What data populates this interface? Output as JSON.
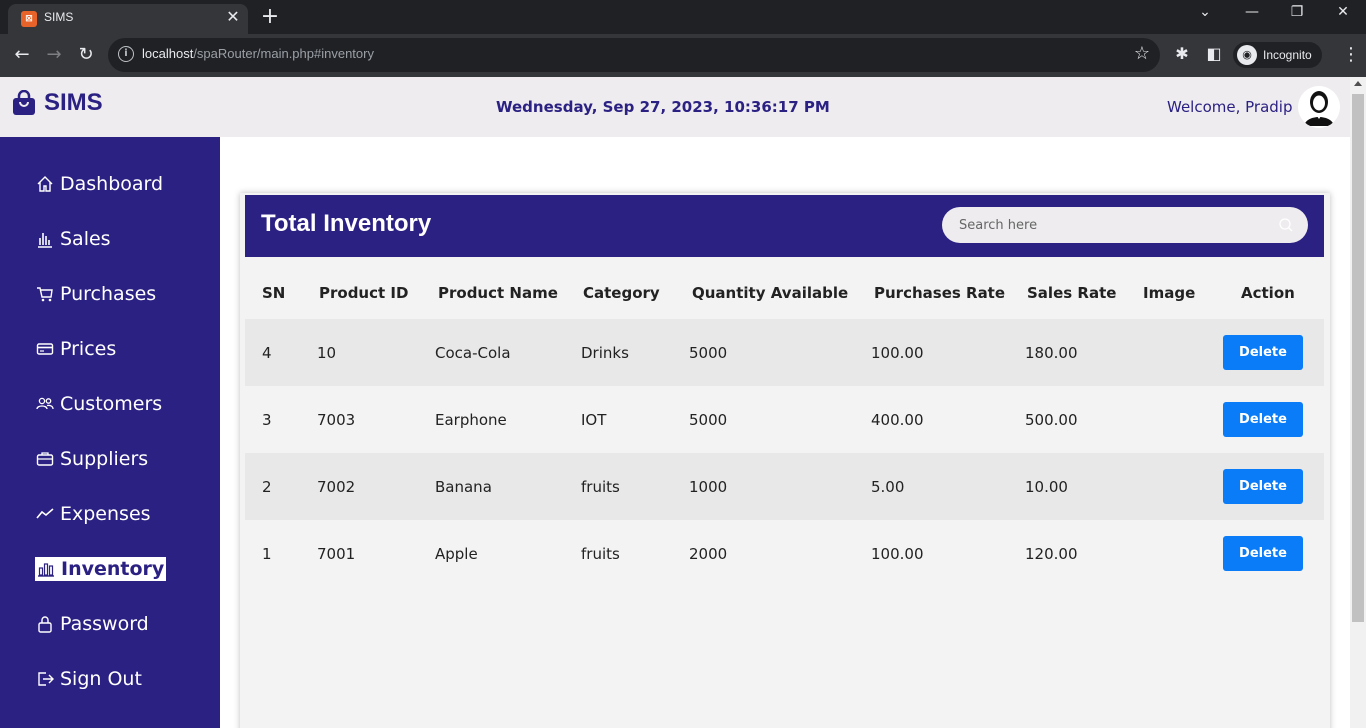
{
  "browser": {
    "tab_title": "SIMS",
    "favicon_text": "⊠",
    "url_host": "localhost",
    "url_path": "/spaRouter/main.php#inventory",
    "incognito_label": "Incognito"
  },
  "header": {
    "logo_text": "SIMS",
    "datetime": "Wednesday, Sep 27, 2023, 10:36:17 PM",
    "welcome": "Welcome, Pradip"
  },
  "sidebar": {
    "items": [
      {
        "label": "Dashboard",
        "icon": "home-icon"
      },
      {
        "label": "Sales",
        "icon": "bar-chart-icon"
      },
      {
        "label": "Purchases",
        "icon": "cart-icon"
      },
      {
        "label": "Prices",
        "icon": "credit-card-icon"
      },
      {
        "label": "Customers",
        "icon": "users-icon"
      },
      {
        "label": "Suppliers",
        "icon": "briefcase-icon"
      },
      {
        "label": "Expenses",
        "icon": "trend-icon"
      },
      {
        "label": "Inventory",
        "icon": "inventory-chart-icon",
        "active": true
      },
      {
        "label": "Password",
        "icon": "lock-icon"
      },
      {
        "label": "Sign Out",
        "icon": "sign-out-icon"
      }
    ]
  },
  "inventory": {
    "title": "Total Inventory",
    "search_placeholder": "Search here",
    "columns": [
      "SN",
      "Product ID",
      "Product Name",
      "Category",
      "Quantity Available",
      "Purchases Rate",
      "Sales Rate",
      "Image",
      "Action"
    ],
    "rows": [
      {
        "sn": "4",
        "product_id": "10",
        "name": "Coca-Cola",
        "category": "Drinks",
        "qty": "5000",
        "purchase_rate": "100.00",
        "sales_rate": "180.00",
        "action": "Delete"
      },
      {
        "sn": "3",
        "product_id": "7003",
        "name": "Earphone",
        "category": "IOT",
        "qty": "5000",
        "purchase_rate": "400.00",
        "sales_rate": "500.00",
        "action": "Delete"
      },
      {
        "sn": "2",
        "product_id": "7002",
        "name": "Banana",
        "category": "fruits",
        "qty": "1000",
        "purchase_rate": "5.00",
        "sales_rate": "10.00",
        "action": "Delete"
      },
      {
        "sn": "1",
        "product_id": "7001",
        "name": "Apple",
        "category": "fruits",
        "qty": "2000",
        "purchase_rate": "100.00",
        "sales_rate": "120.00",
        "action": "Delete"
      }
    ]
  },
  "colors": {
    "brand": "#2b2183",
    "delete_button": "#0a7cf7"
  }
}
